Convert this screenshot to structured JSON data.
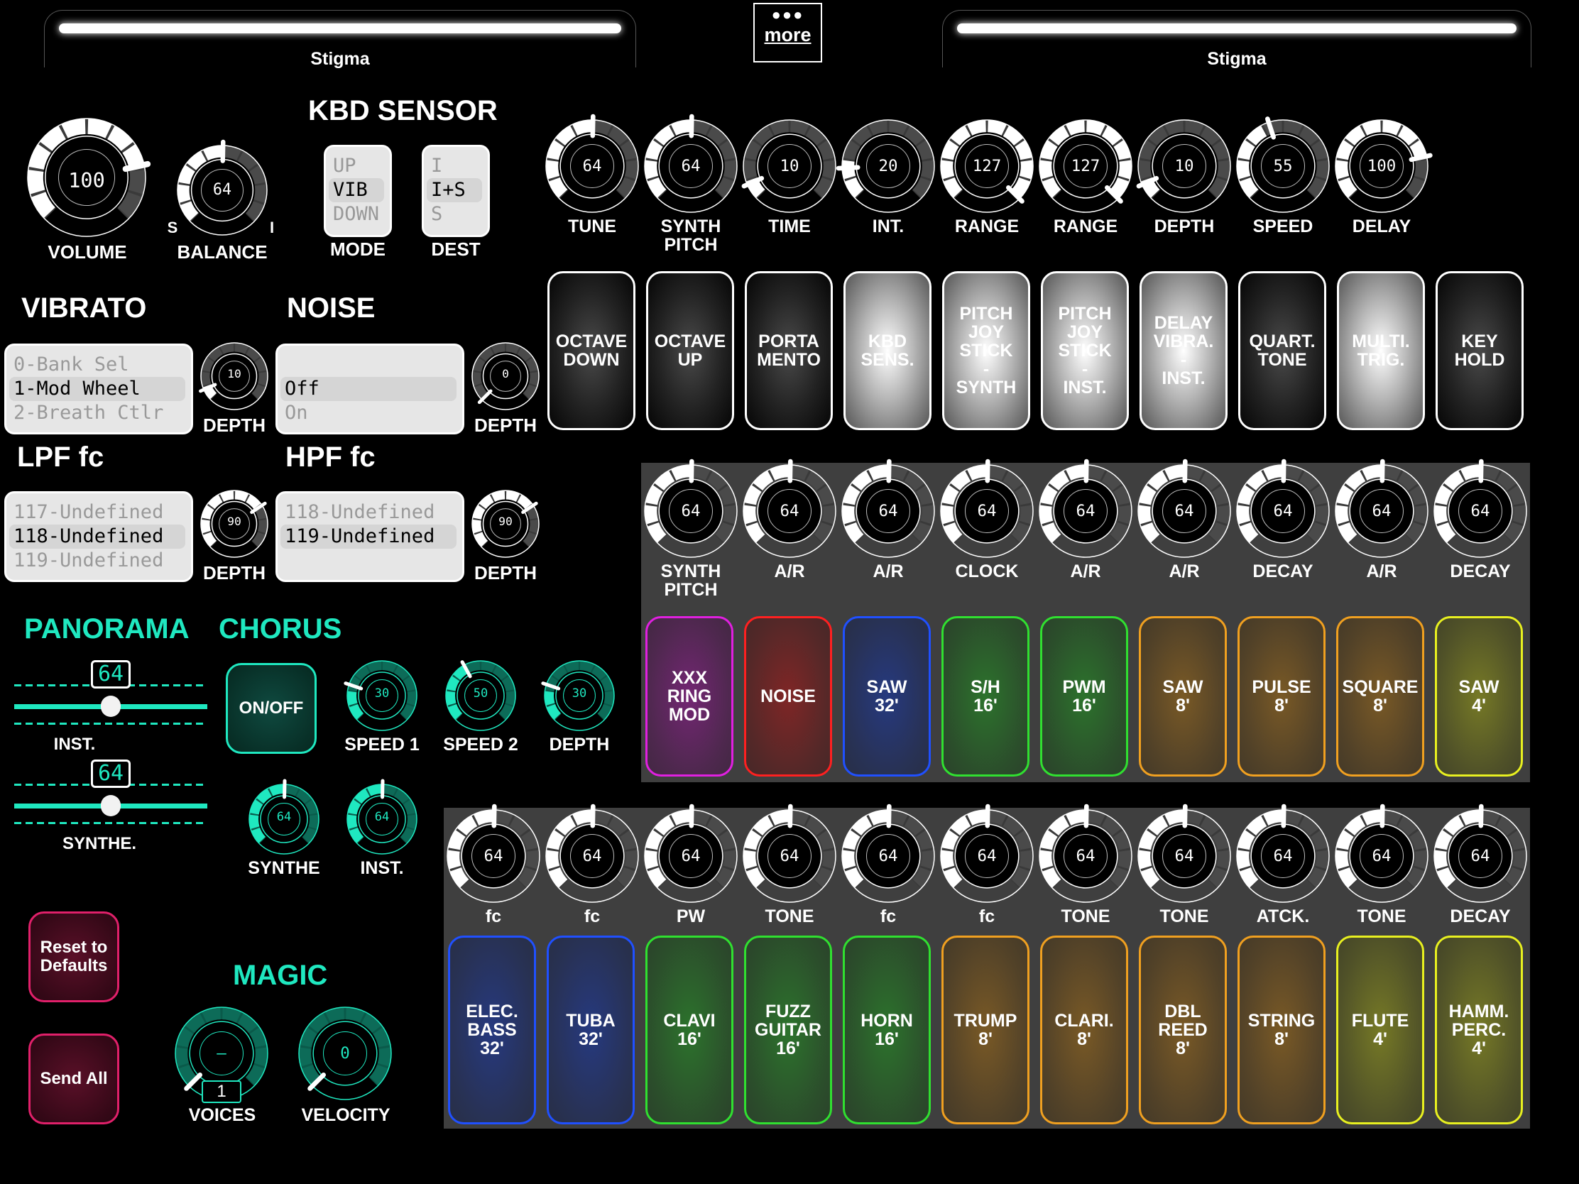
{
  "presets": {
    "left": "Stigma",
    "right": "Stigma"
  },
  "more": {
    "label": "more"
  },
  "kbd_sensor": {
    "title": "KBD SENSOR",
    "mode": {
      "label": "MODE",
      "options": [
        "UP",
        "VIB",
        "DOWN"
      ],
      "selected": "VIB"
    },
    "dest": {
      "label": "DEST",
      "options": [
        "I",
        "I+S",
        "S"
      ],
      "selected": "I+S"
    }
  },
  "volume": {
    "label": "VOLUME",
    "value": "100"
  },
  "balance": {
    "label": "BALANCE",
    "value": "64",
    "left": "S",
    "right": "I"
  },
  "top_knobs": [
    {
      "label": "TUNE",
      "value": "64"
    },
    {
      "label": "SYNTH\nPITCH",
      "value": "64"
    },
    {
      "label": "TIME",
      "value": "10"
    },
    {
      "label": "INT.",
      "value": "20"
    },
    {
      "label": "RANGE",
      "value": "127"
    },
    {
      "label": "RANGE",
      "value": "127"
    },
    {
      "label": "DEPTH",
      "value": "10"
    },
    {
      "label": "SPEED",
      "value": "55"
    },
    {
      "label": "DELAY",
      "value": "100"
    }
  ],
  "top_buttons": [
    {
      "label": "OCTAVE\nDOWN",
      "on": false
    },
    {
      "label": "OCTAVE\nUP",
      "on": false
    },
    {
      "label": "PORTA\nMENTO",
      "on": false
    },
    {
      "label": "KBD\nSENS.",
      "on": true
    },
    {
      "label": "PITCH\nJOY\nSTICK\n-\nSYNTH",
      "on": true
    },
    {
      "label": "PITCH\nJOY\nSTICK\n-\nINST.",
      "on": true
    },
    {
      "label": "DELAY\nVIBRA.\n-\nINST.",
      "on": true
    },
    {
      "label": "QUART.\nTONE",
      "on": false
    },
    {
      "label": "MULTI.\nTRIG.",
      "on": true
    },
    {
      "label": "KEY\nHOLD",
      "on": false
    }
  ],
  "vibrato": {
    "title": "VIBRATO",
    "options": [
      "0-Bank Sel",
      "1-Mod Wheel",
      "2-Breath Ctlr"
    ],
    "selected": "1-Mod Wheel",
    "depth_label": "DEPTH",
    "depth_value": "10"
  },
  "noise": {
    "title": "NOISE",
    "options": [
      "",
      "Off",
      "On"
    ],
    "selected": "Off",
    "depth_label": "DEPTH",
    "depth_value": "0"
  },
  "lpf": {
    "title": "LPF fc",
    "options": [
      "117-Undefined",
      "118-Undefined",
      "119-Undefined"
    ],
    "selected": "118-Undefined",
    "depth_label": "DEPTH",
    "depth_value": "90"
  },
  "hpf": {
    "title": "HPF fc",
    "options": [
      "118-Undefined",
      "119-Undefined",
      ""
    ],
    "selected": "119-Undefined",
    "depth_label": "DEPTH",
    "depth_value": "90"
  },
  "synth_knobs": [
    {
      "label": "SYNTH\nPITCH",
      "value": "64"
    },
    {
      "label": "A/R",
      "value": "64"
    },
    {
      "label": "A/R",
      "value": "64"
    },
    {
      "label": "CLOCK",
      "value": "64"
    },
    {
      "label": "A/R",
      "value": "64"
    },
    {
      "label": "A/R",
      "value": "64"
    },
    {
      "label": "DECAY",
      "value": "64"
    },
    {
      "label": "A/R",
      "value": "64"
    },
    {
      "label": "DECAY",
      "value": "64"
    }
  ],
  "synth_tabs": [
    {
      "label": "XXX\nRING\nMOD",
      "color": "#e020e0"
    },
    {
      "label": "NOISE",
      "color": "#ff2020"
    },
    {
      "label": "SAW\n32'",
      "color": "#2050ff"
    },
    {
      "label": "S/H\n16'",
      "color": "#30e030"
    },
    {
      "label": "PWM\n16'",
      "color": "#30e030"
    },
    {
      "label": "SAW\n8'",
      "color": "#f0a020"
    },
    {
      "label": "PULSE\n8'",
      "color": "#f0a020"
    },
    {
      "label": "SQUARE\n8'",
      "color": "#f0a020"
    },
    {
      "label": "SAW\n4'",
      "color": "#e8f020"
    }
  ],
  "inst_knobs": [
    {
      "label": "fc",
      "value": "64"
    },
    {
      "label": "fc",
      "value": "64"
    },
    {
      "label": "PW",
      "value": "64"
    },
    {
      "label": "TONE",
      "value": "64"
    },
    {
      "label": "fc",
      "value": "64"
    },
    {
      "label": "fc",
      "value": "64"
    },
    {
      "label": "TONE",
      "value": "64"
    },
    {
      "label": "TONE",
      "value": "64"
    },
    {
      "label": "ATCK.",
      "value": "64"
    },
    {
      "label": "TONE",
      "value": "64"
    },
    {
      "label": "DECAY",
      "value": "64"
    }
  ],
  "inst_tabs": [
    {
      "label": "ELEC.\nBASS\n32'",
      "color": "#2050ff"
    },
    {
      "label": "TUBA\n32'",
      "color": "#2050ff"
    },
    {
      "label": "CLAVI\n16'",
      "color": "#30e030"
    },
    {
      "label": "FUZZ\nGUITAR\n16'",
      "color": "#30e030"
    },
    {
      "label": "HORN\n16'",
      "color": "#30e030"
    },
    {
      "label": "TRUMP\n8'",
      "color": "#f0a020"
    },
    {
      "label": "CLARI.\n8'",
      "color": "#f0a020"
    },
    {
      "label": "DBL\nREED\n8'",
      "color": "#f0a020"
    },
    {
      "label": "STRING\n8'",
      "color": "#f0a020"
    },
    {
      "label": "FLUTE\n4'",
      "color": "#e8f020"
    },
    {
      "label": "HAMM.\nPERC.\n4'",
      "color": "#e8f020"
    }
  ],
  "panorama": {
    "title": "PANORAMA",
    "inst_label": "INST.",
    "inst_value": "64",
    "synth_label": "SYNTHE.",
    "synth_value": "64"
  },
  "chorus": {
    "title": "CHORUS",
    "onoff_label": "ON/OFF",
    "knobs": [
      {
        "label": "SPEED 1",
        "value": "30"
      },
      {
        "label": "SPEED 2",
        "value": "50"
      },
      {
        "label": "DEPTH",
        "value": "30"
      },
      {
        "label": "SYNTHE",
        "value": "64"
      },
      {
        "label": "INST.",
        "value": "64"
      }
    ]
  },
  "magic": {
    "title": "MAGIC",
    "voices_label": "VOICES",
    "voices_value": "—",
    "voices_count": "1",
    "velocity_label": "VELOCITY",
    "velocity_value": "0"
  },
  "actions": {
    "reset_label": "Reset to\nDefaults",
    "send_label": "Send All"
  },
  "colors": {
    "accent_teal": "#1fe8c0",
    "action_pink": "#e0206a",
    "panel_gray": "#3f3f3f"
  }
}
